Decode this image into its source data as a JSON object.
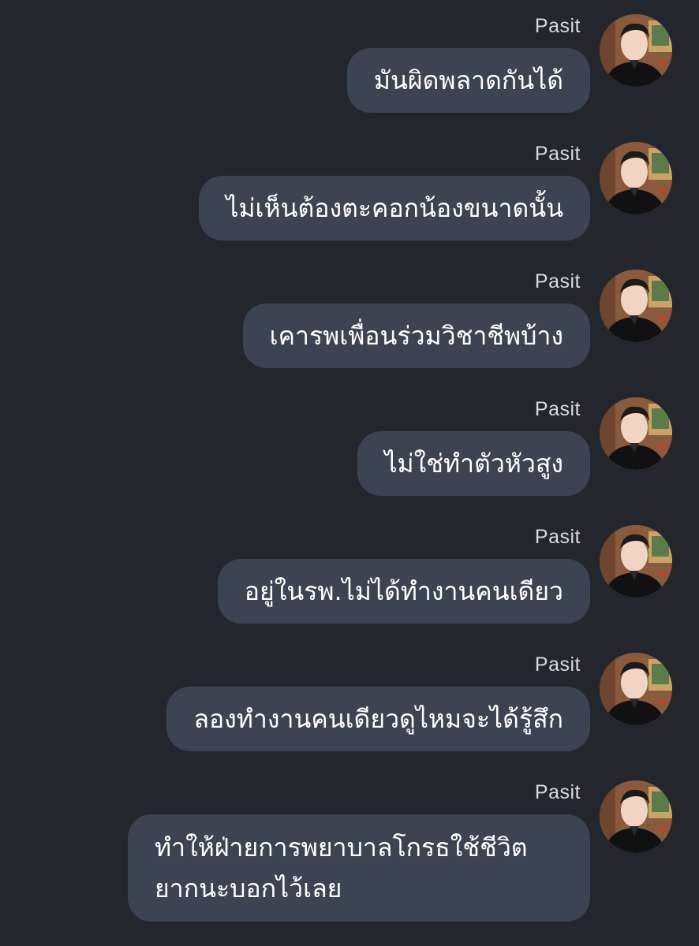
{
  "messages": [
    {
      "sender": "Pasit",
      "lines": [
        "มันผิดพลาดกันได้"
      ]
    },
    {
      "sender": "Pasit",
      "lines": [
        "ไม่เห็นต้องตะคอกน้องขนาดนั้น"
      ]
    },
    {
      "sender": "Pasit",
      "lines": [
        "เคารพเพื่อนร่วมวิชาชีพบ้าง"
      ]
    },
    {
      "sender": "Pasit",
      "lines": [
        "ไม่ใช่ทำตัวหัวสูง"
      ]
    },
    {
      "sender": "Pasit",
      "lines": [
        "อยู่ในรพ.ไม่ได้ทำงานคนเดียว"
      ]
    },
    {
      "sender": "Pasit",
      "lines": [
        "ลองทำงานคนเดียวดูไหมจะได้รู้สึก"
      ]
    },
    {
      "sender": "Pasit",
      "lines": [
        "ทำให้ฝ่ายการพยาบาลโกรธใช้ชีวิต",
        "ยากนะบอกไว้เลย"
      ]
    }
  ],
  "avatar": {
    "icon": "profile-photo-avatar"
  },
  "colors": {
    "background": "#24262d",
    "bubble": "#3c4454",
    "text": "#ffffff",
    "sender": "#d8dade"
  }
}
